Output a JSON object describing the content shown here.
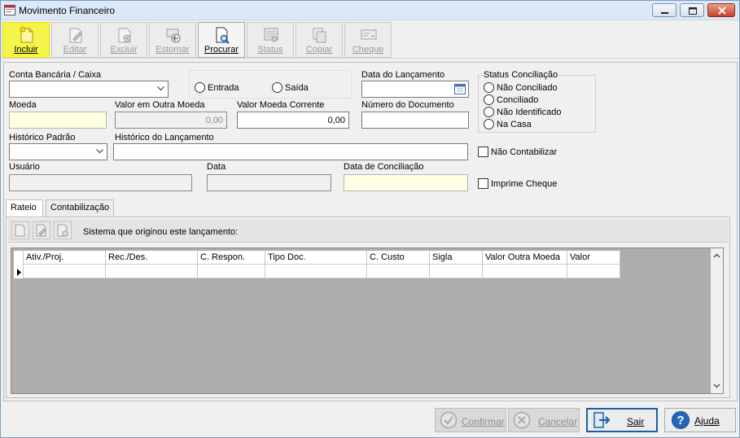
{
  "window": {
    "title": "Movimento Financeiro"
  },
  "toolbar": {
    "incluir": "Incluir",
    "editar": "Editar",
    "excluir": "Excluir",
    "estornar": "Estornar",
    "procurar": "Procurar",
    "status": "Status",
    "copiar": "Copiar",
    "cheque": "Cheque"
  },
  "form": {
    "conta_label": "Conta Bancária / Caixa",
    "conta_value": "",
    "entrada_label": "Entrada",
    "saida_label": "Saída",
    "data_lancamento_label": "Data do Lançamento",
    "data_lancamento_value": "",
    "status_conciliacao_label": "Status Conciliação",
    "status_options": [
      "Não Conciliado",
      "Conciliado",
      "Não Identificado",
      "Na Casa"
    ],
    "moeda_label": "Moeda",
    "moeda_value": "",
    "valor_outra_moeda_label": "Valor em Outra Moeda",
    "valor_outra_moeda_value": "0,00",
    "valor_moeda_corrente_label": "Valor Moeda Corrente",
    "valor_moeda_corrente_value": "0,00",
    "numero_documento_label": "Número do Documento",
    "numero_documento_value": "",
    "historico_padrao_label": "Histórico Padrão",
    "historico_padrao_value": "",
    "historico_lancamento_label": "Histórico do Lançamento",
    "historico_lancamento_value": "",
    "nao_contabilizar_label": "Não Contabilizar",
    "usuario_label": "Usuário",
    "usuario_value": "",
    "data_label": "Data",
    "data_value": "",
    "data_conciliacao_label": "Data de Conciliação",
    "data_conciliacao_value": "",
    "imprime_cheque_label": "Imprime Cheque"
  },
  "tabs": [
    "Rateio",
    "Contabilização"
  ],
  "rateio": {
    "sistema_label": "Sistema que originou este lançamento:",
    "columns": [
      "Ativ./Proj.",
      "Rec./Des.",
      "C. Respon.",
      "Tipo Doc.",
      "C. Custo",
      "Sigla",
      "Valor Outra Moeda",
      "Valor"
    ]
  },
  "footer": {
    "confirmar": "Confirmar",
    "cancelar": "Cancelar",
    "sair": "Sair",
    "ajuda": "Ajuda"
  },
  "colors": {
    "highlight": "#f4f44a",
    "accent": "#1e5ea8",
    "field_yellow": "#ffffe1"
  }
}
